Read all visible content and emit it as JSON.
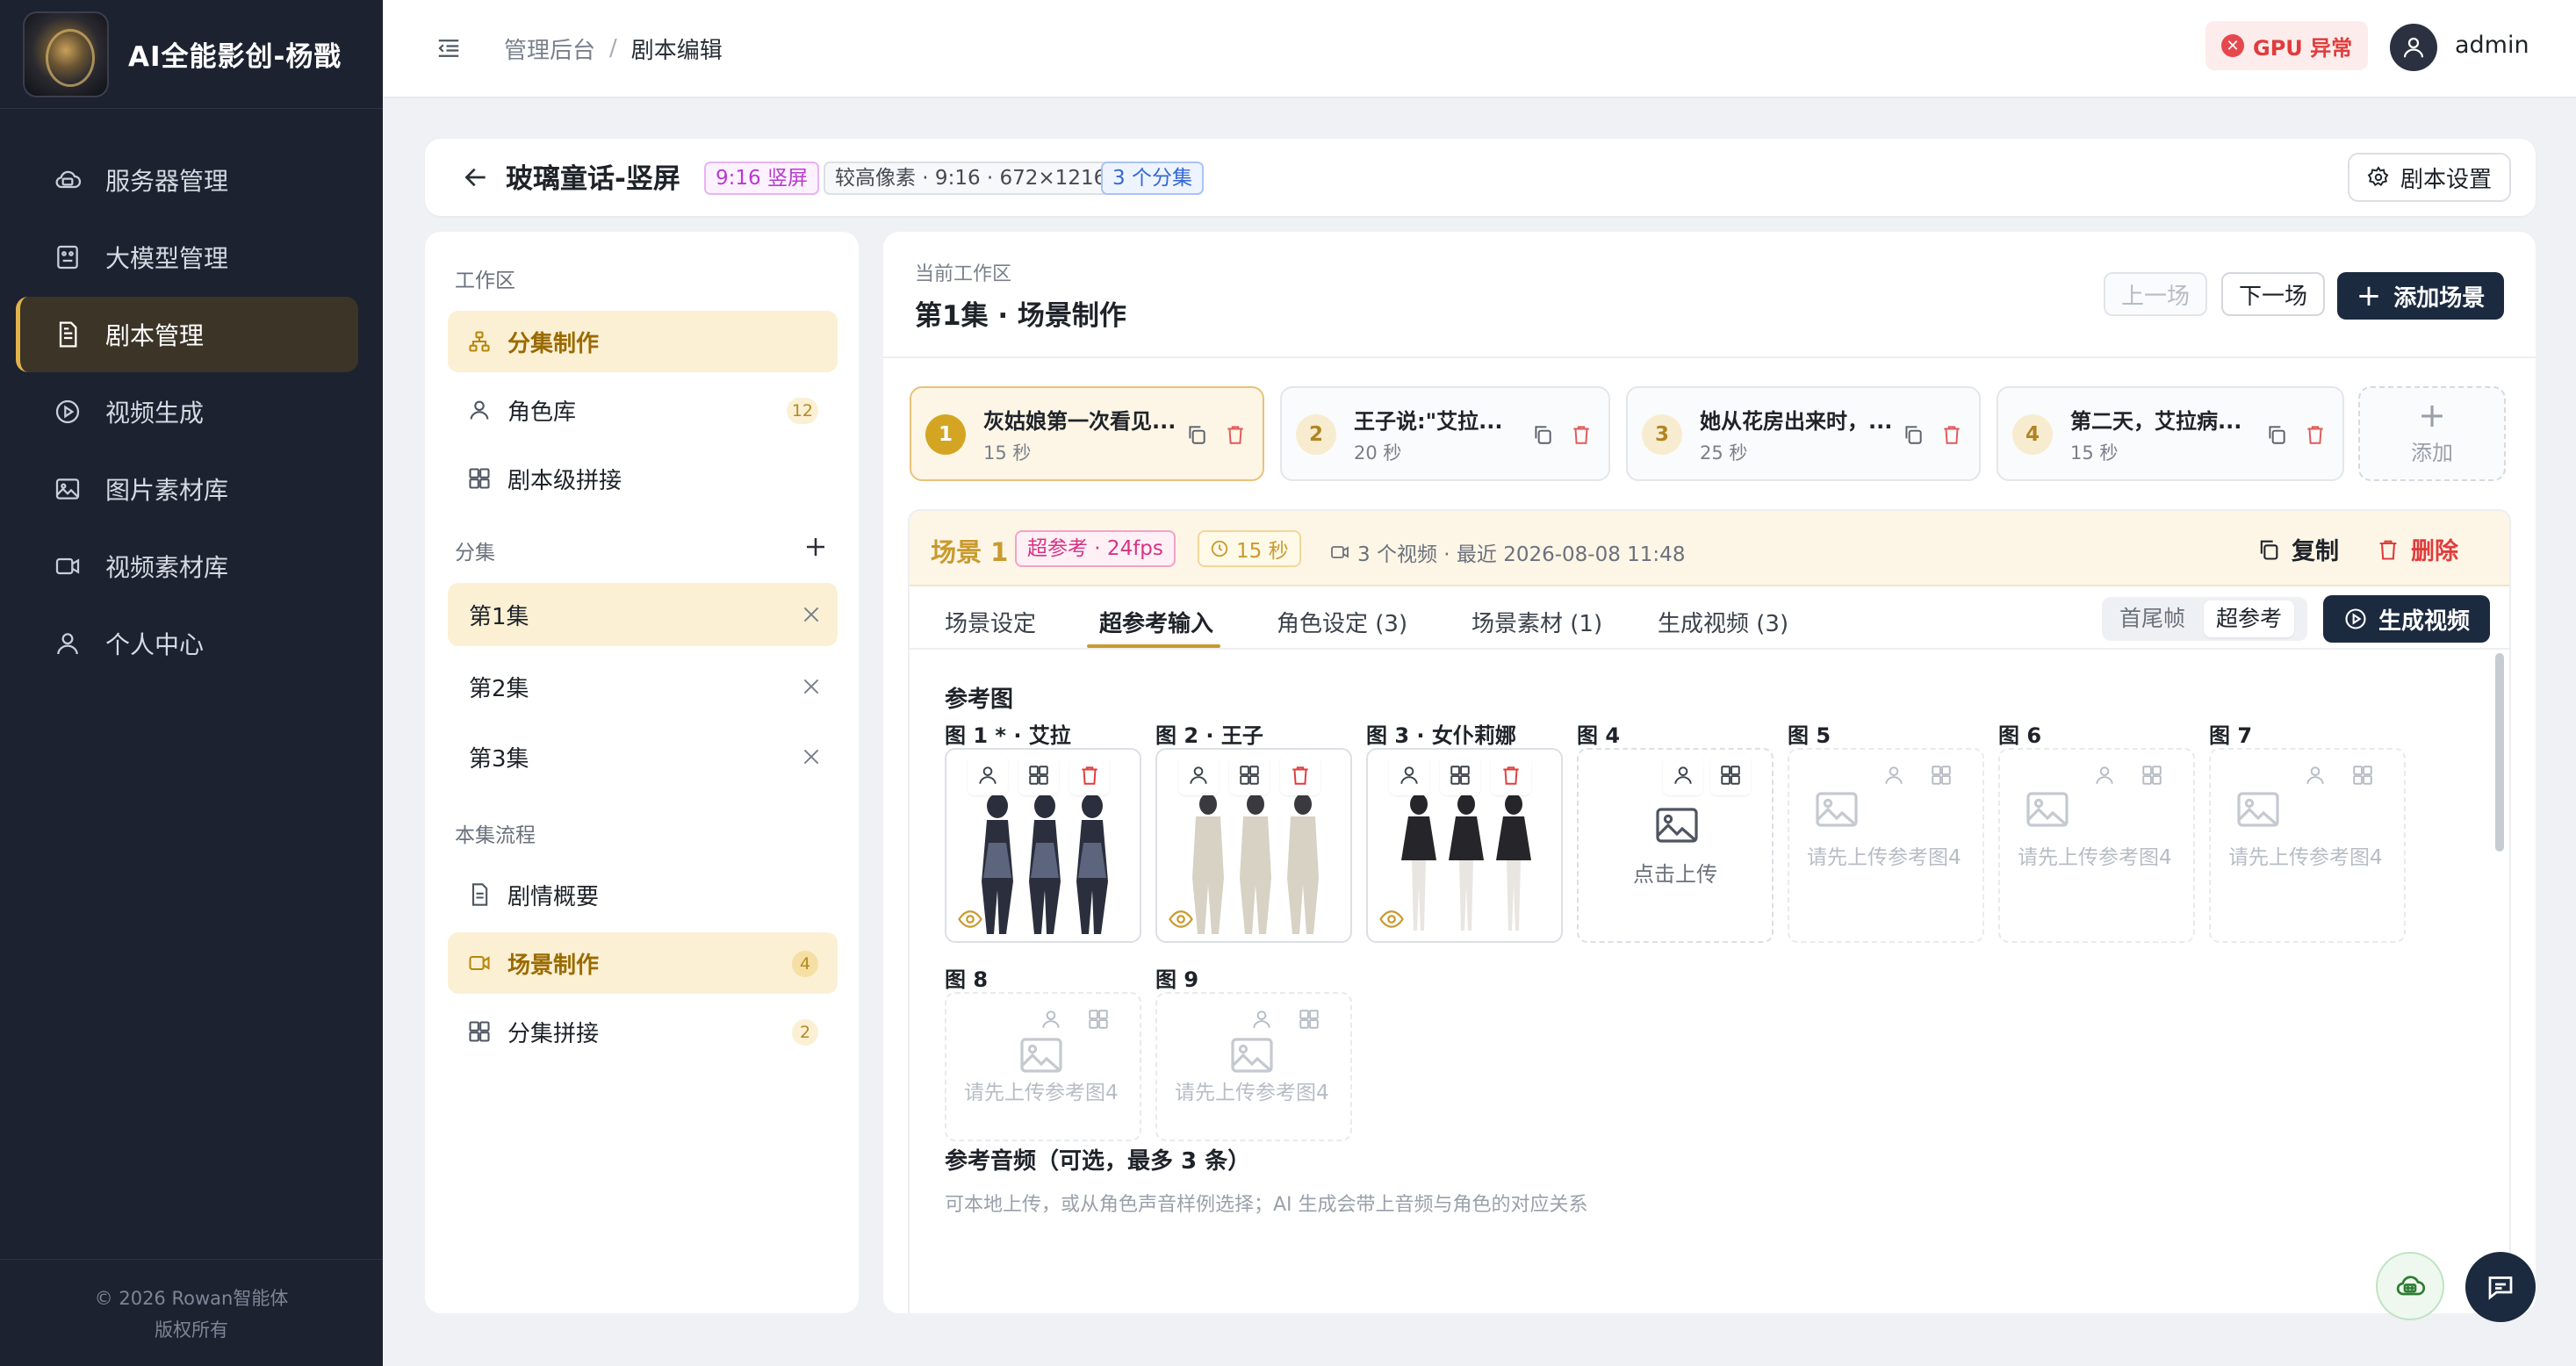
{
  "app": {
    "title": "AI全能影创-杨戬",
    "copyright": "© 2026 Rowan智能体",
    "rights": "版权所有"
  },
  "nav": [
    {
      "label": "服务器管理",
      "icon": "server-icon"
    },
    {
      "label": "大模型管理",
      "icon": "model-icon"
    },
    {
      "label": "剧本管理",
      "icon": "document-icon",
      "active": true
    },
    {
      "label": "视频生成",
      "icon": "play-circle-icon"
    },
    {
      "label": "图片素材库",
      "icon": "image-icon"
    },
    {
      "label": "视频素材库",
      "icon": "video-icon"
    },
    {
      "label": "个人中心",
      "icon": "user-icon"
    }
  ],
  "topbar": {
    "breadcrumb": [
      "管理后台",
      "/",
      "剧本编辑"
    ],
    "gpu_status": "GPU 异常",
    "user": "admin"
  },
  "header": {
    "title": "玻璃童话-竖屏",
    "ratio_tag": "9:16 竖屏",
    "res_tag": "较高像素 · 9:16 · 672×1216",
    "episodes_tag": "3 个分集",
    "settings_label": "剧本设置"
  },
  "left": {
    "workspace_title": "工作区",
    "workspace_items": [
      {
        "label": "分集制作",
        "icon": "sitemap-icon",
        "active": true
      },
      {
        "label": "角色库",
        "icon": "user-icon",
        "count": "12"
      },
      {
        "label": "剧本级拼接",
        "icon": "grid-icon"
      }
    ],
    "episodes_title": "分集",
    "episodes": [
      {
        "label": "第1集",
        "active": true
      },
      {
        "label": "第2集"
      },
      {
        "label": "第3集"
      }
    ],
    "flow_title": "本集流程",
    "flow_items": [
      {
        "label": "剧情概要",
        "icon": "document-icon"
      },
      {
        "label": "场景制作",
        "icon": "video-icon",
        "count": "4",
        "active": true
      },
      {
        "label": "分集拼接",
        "icon": "grid-icon",
        "count": "2"
      }
    ]
  },
  "main": {
    "ws_label": "当前工作区",
    "ws_title": "第1集 · 场景制作",
    "prev_label": "上一场",
    "next_label": "下一场",
    "add_scene_label": "添加场景",
    "add_card_plus": "+",
    "add_card_label": "添加",
    "scenes": [
      {
        "num": "1",
        "text": "灰姑娘第一次看见...",
        "duration": "15 秒",
        "active": true
      },
      {
        "num": "2",
        "text": "王子说:\"艾拉...",
        "duration": "20 秒"
      },
      {
        "num": "3",
        "text": "她从花房出来时，...",
        "duration": "25 秒"
      },
      {
        "num": "4",
        "text": "第二天，艾拉病...",
        "duration": "15 秒"
      }
    ],
    "scene": {
      "title": "场景 1",
      "tag": "超参考 · 24fps",
      "duration": "15 秒",
      "meta": "3 个视频 · 最近 2026-08-08 11:48",
      "copy_label": "复制",
      "delete_label": "删除"
    },
    "tabs": [
      "场景设定",
      "超参考输入",
      "角色设定 (3)",
      "场景素材 (1)",
      "生成视频 (3)"
    ],
    "active_tab": 1,
    "modes": [
      "首尾帧",
      "超参考"
    ],
    "active_mode": 1,
    "generate_label": "生成视频",
    "ref_title": "参考图",
    "refs": [
      {
        "label": "图 1 * · 艾拉",
        "state": "filled"
      },
      {
        "label": "图 2 · 王子",
        "state": "filled"
      },
      {
        "label": "图 3 · 女仆莉娜",
        "state": "filled"
      },
      {
        "label": "图 4",
        "state": "upload",
        "text": "点击上传"
      },
      {
        "label": "图 5",
        "state": "empty",
        "text": "请先上传参考图4"
      },
      {
        "label": "图 6",
        "state": "empty",
        "text": "请先上传参考图4"
      },
      {
        "label": "图 7",
        "state": "empty",
        "text": "请先上传参考图4"
      },
      {
        "label": "图 8",
        "state": "empty",
        "text": "请先上传参考图4"
      },
      {
        "label": "图 9",
        "state": "empty",
        "text": "请先上传参考图4"
      }
    ],
    "audio_title": "参考音频（可选，最多 3 条）",
    "audio_desc": "可本地上传，或从角色声音样例选择；AI 生成会带上音频与角色的对应关系"
  },
  "colors": {
    "accent": "#c99a2e",
    "sidebar_bg": "#1c2230",
    "primary_btn": "#1c2a3f",
    "danger": "#e03c3c"
  }
}
